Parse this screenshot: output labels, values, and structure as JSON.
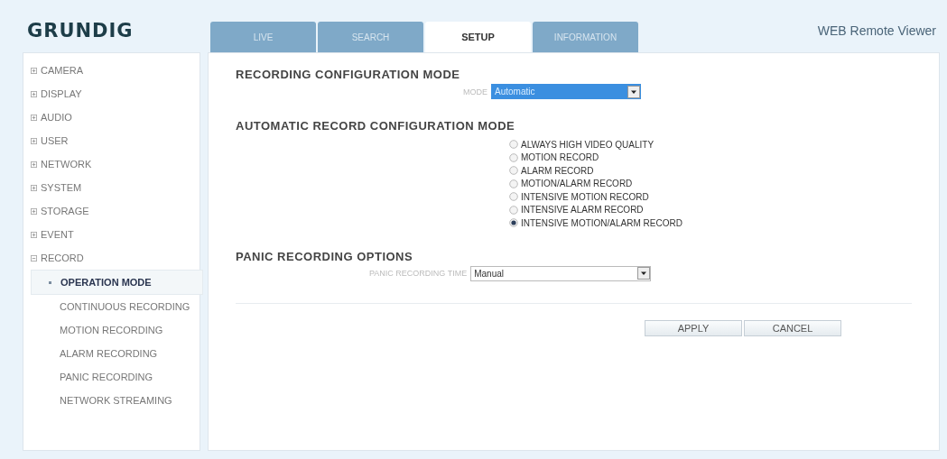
{
  "logo": "GRUNDIG",
  "tabs": [
    {
      "label": "LIVE",
      "selected": false
    },
    {
      "label": "SEARCH",
      "selected": false
    },
    {
      "label": "SETUP",
      "selected": true
    },
    {
      "label": "INFORMATION",
      "selected": false
    }
  ],
  "app_title": "WEB Remote Viewer",
  "sidebar": {
    "items": [
      {
        "label": "CAMERA",
        "expanded": false
      },
      {
        "label": "DISPLAY",
        "expanded": false
      },
      {
        "label": "AUDIO",
        "expanded": false
      },
      {
        "label": "USER",
        "expanded": false
      },
      {
        "label": "NETWORK",
        "expanded": false
      },
      {
        "label": "SYSTEM",
        "expanded": false
      },
      {
        "label": "STORAGE",
        "expanded": false
      },
      {
        "label": "EVENT",
        "expanded": false
      },
      {
        "label": "RECORD",
        "expanded": true,
        "children": [
          {
            "label": "OPERATION MODE",
            "selected": true
          },
          {
            "label": "CONTINUOUS RECORDING",
            "selected": false
          },
          {
            "label": "MOTION RECORDING",
            "selected": false
          },
          {
            "label": "ALARM RECORDING",
            "selected": false
          },
          {
            "label": "PANIC RECORDING",
            "selected": false
          },
          {
            "label": "NETWORK STREAMING",
            "selected": false
          }
        ]
      }
    ]
  },
  "sections": [
    {
      "title": "RECORDING CONFIGURATION MODE",
      "kind": "select",
      "label": "MODE",
      "value": "Automatic",
      "focused": true
    },
    {
      "title": "AUTOMATIC RECORD CONFIGURATION MODE",
      "kind": "radios",
      "options": [
        {
          "label": "ALWAYS HIGH VIDEO QUALITY",
          "selected": false
        },
        {
          "label": "MOTION RECORD",
          "selected": false
        },
        {
          "label": "ALARM RECORD",
          "selected": false
        },
        {
          "label": "MOTION/ALARM RECORD",
          "selected": false
        },
        {
          "label": "INTENSIVE MOTION RECORD",
          "selected": false
        },
        {
          "label": "INTENSIVE ALARM RECORD",
          "selected": false
        },
        {
          "label": "INTENSIVE MOTION/ALARM RECORD",
          "selected": true
        }
      ]
    },
    {
      "title": "PANIC RECORDING OPTIONS",
      "kind": "select",
      "label": "PANIC RECORDING TIME",
      "value": "Manual",
      "focused": false
    }
  ],
  "buttons": [
    "APPLY",
    "CANCEL"
  ]
}
